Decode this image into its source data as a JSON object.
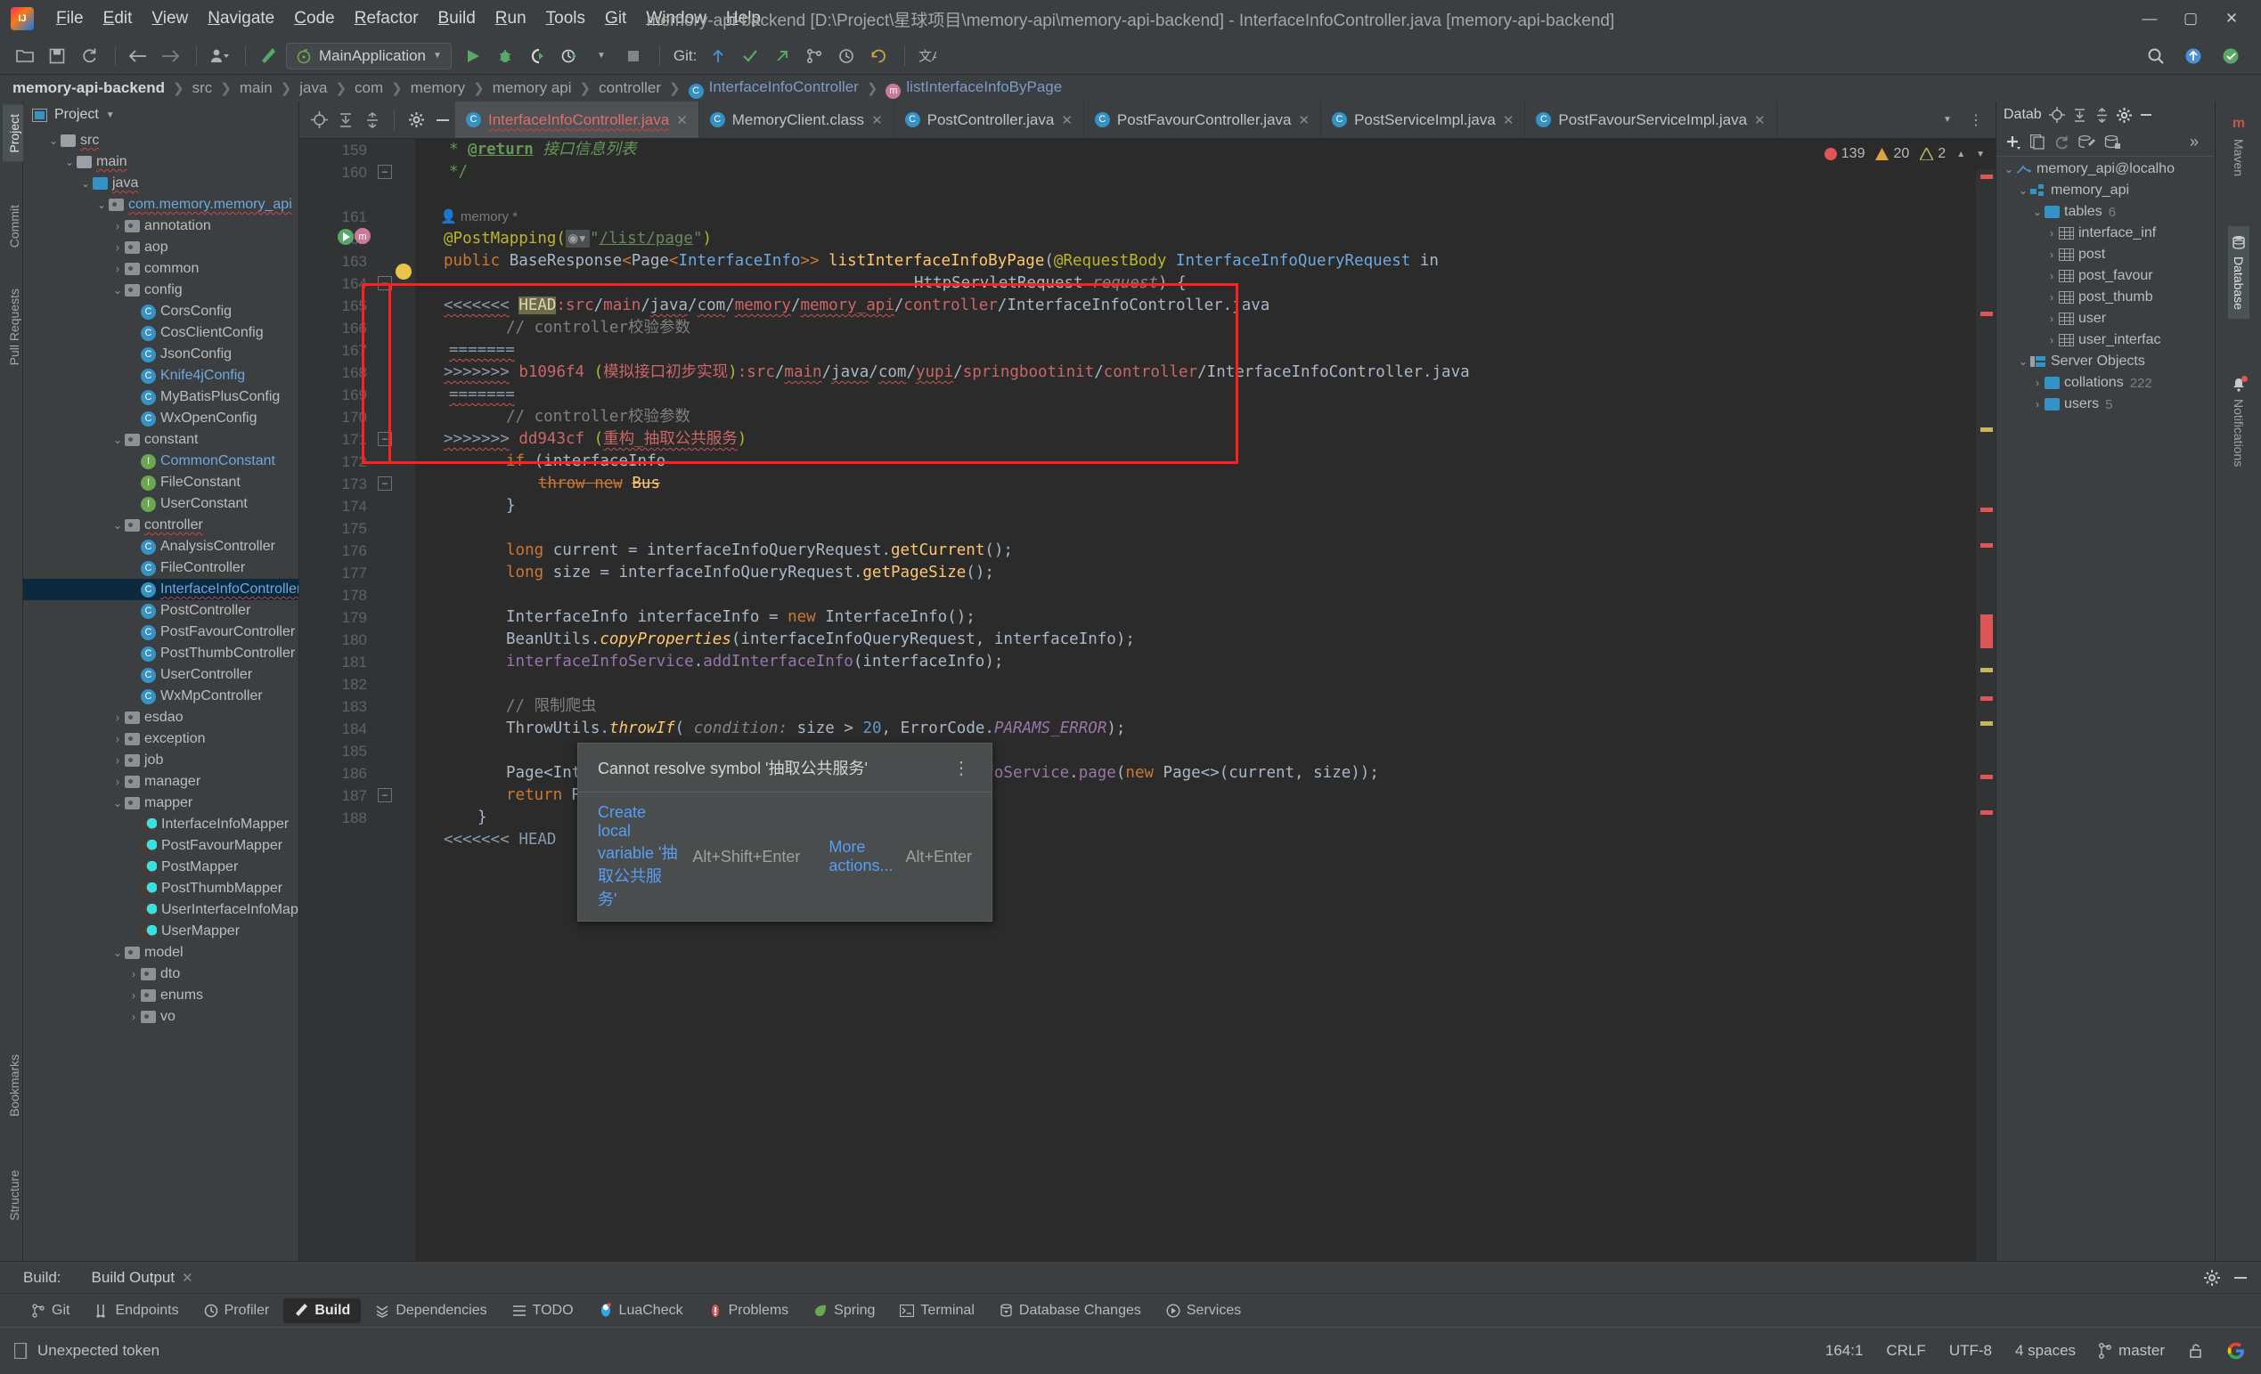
{
  "window": {
    "title": "memory-api-backend [D:\\Project\\星球项目\\memory-api\\memory-api-backend] - InterfaceInfoController.java [memory-api-backend]",
    "minimize": "—",
    "maximize": "▢",
    "close": "✕"
  },
  "menu": [
    "File",
    "Edit",
    "View",
    "Navigate",
    "Code",
    "Refactor",
    "Build",
    "Run",
    "Tools",
    "Git",
    "Window",
    "Help"
  ],
  "toolbar": {
    "run_configuration": "MainApplication",
    "git_label": "Git:",
    "icons": [
      "open-folder-icon",
      "save-icon",
      "sync-icon",
      "back-arrow-icon",
      "forward-arrow-icon",
      "user-icon",
      "build-hammer-icon",
      "run-icon",
      "debug-icon",
      "run-coverage-icon",
      "profile-icon",
      "stop-icon"
    ],
    "right_icons": [
      "search-everywhere-icon",
      "update-project-icon",
      "ide-settings-icon"
    ]
  },
  "breadcrumbs": [
    {
      "label": "memory-api-backend",
      "kind": "root"
    },
    {
      "label": "src",
      "kind": "plain"
    },
    {
      "label": "main",
      "kind": "plain"
    },
    {
      "label": "java",
      "kind": "plain"
    },
    {
      "label": "com",
      "kind": "plain"
    },
    {
      "label": "memory",
      "kind": "plain"
    },
    {
      "label": "memory api",
      "kind": "plain"
    },
    {
      "label": "controller",
      "kind": "plain"
    },
    {
      "label": "InterfaceInfoController",
      "kind": "class"
    },
    {
      "label": "listInterfaceInfoByPage",
      "kind": "method"
    }
  ],
  "left_stripe": [
    "Project",
    "Commit",
    "Pull Requests",
    "Bookmarks",
    "Structure"
  ],
  "project": {
    "title": "Project",
    "nodes": [
      {
        "depth": 1,
        "label": "src",
        "icon": "folder-grey",
        "state": "expanded",
        "err": true
      },
      {
        "depth": 2,
        "label": "main",
        "icon": "folder-grey",
        "state": "expanded",
        "err": true
      },
      {
        "depth": 3,
        "label": "java",
        "icon": "folder-blue",
        "state": "expanded",
        "err": true
      },
      {
        "depth": 4,
        "label": "com.memory.memory_api",
        "icon": "package",
        "state": "expanded",
        "blue": true,
        "err": true
      },
      {
        "depth": 5,
        "label": "annotation",
        "icon": "package",
        "state": "collapsed"
      },
      {
        "depth": 5,
        "label": "aop",
        "icon": "package",
        "state": "collapsed"
      },
      {
        "depth": 5,
        "label": "common",
        "icon": "package",
        "state": "collapsed"
      },
      {
        "depth": 5,
        "label": "config",
        "icon": "package",
        "state": "expanded"
      },
      {
        "depth": 6,
        "label": "CorsConfig",
        "icon": "class"
      },
      {
        "depth": 6,
        "label": "CosClientConfig",
        "icon": "class"
      },
      {
        "depth": 6,
        "label": "JsonConfig",
        "icon": "class"
      },
      {
        "depth": 6,
        "label": "Knife4jConfig",
        "icon": "class",
        "blue": true
      },
      {
        "depth": 6,
        "label": "MyBatisPlusConfig",
        "icon": "class"
      },
      {
        "depth": 6,
        "label": "WxOpenConfig",
        "icon": "class"
      },
      {
        "depth": 5,
        "label": "constant",
        "icon": "package",
        "state": "expanded"
      },
      {
        "depth": 6,
        "label": "CommonConstant",
        "icon": "interface",
        "blue": true
      },
      {
        "depth": 6,
        "label": "FileConstant",
        "icon": "interface"
      },
      {
        "depth": 6,
        "label": "UserConstant",
        "icon": "interface"
      },
      {
        "depth": 5,
        "label": "controller",
        "icon": "package",
        "state": "expanded",
        "err": true
      },
      {
        "depth": 6,
        "label": "AnalysisController",
        "icon": "class"
      },
      {
        "depth": 6,
        "label": "FileController",
        "icon": "class"
      },
      {
        "depth": 6,
        "label": "InterfaceInfoController",
        "icon": "class",
        "selected": true,
        "blue": true,
        "err": true
      },
      {
        "depth": 6,
        "label": "PostController",
        "icon": "class"
      },
      {
        "depth": 6,
        "label": "PostFavourController",
        "icon": "class"
      },
      {
        "depth": 6,
        "label": "PostThumbController",
        "icon": "class"
      },
      {
        "depth": 6,
        "label": "UserController",
        "icon": "class"
      },
      {
        "depth": 6,
        "label": "WxMpController",
        "icon": "class"
      },
      {
        "depth": 5,
        "label": "esdao",
        "icon": "package",
        "state": "collapsed"
      },
      {
        "depth": 5,
        "label": "exception",
        "icon": "package",
        "state": "collapsed"
      },
      {
        "depth": 5,
        "label": "job",
        "icon": "package",
        "state": "collapsed"
      },
      {
        "depth": 5,
        "label": "manager",
        "icon": "package",
        "state": "collapsed"
      },
      {
        "depth": 5,
        "label": "mapper",
        "icon": "package",
        "state": "expanded"
      },
      {
        "depth": 6,
        "label": "InterfaceInfoMapper",
        "icon": "mybatis"
      },
      {
        "depth": 6,
        "label": "PostFavourMapper",
        "icon": "mybatis"
      },
      {
        "depth": 6,
        "label": "PostMapper",
        "icon": "mybatis"
      },
      {
        "depth": 6,
        "label": "PostThumbMapper",
        "icon": "mybatis"
      },
      {
        "depth": 6,
        "label": "UserInterfaceInfoMapper",
        "icon": "mybatis"
      },
      {
        "depth": 6,
        "label": "UserMapper",
        "icon": "mybatis"
      },
      {
        "depth": 5,
        "label": "model",
        "icon": "package",
        "state": "expanded"
      },
      {
        "depth": 6,
        "label": "dto",
        "icon": "package",
        "state": "collapsed"
      },
      {
        "depth": 6,
        "label": "enums",
        "icon": "package",
        "state": "collapsed"
      },
      {
        "depth": 6,
        "label": "vo",
        "icon": "package",
        "state": "collapsed"
      }
    ]
  },
  "editor": {
    "tabs": [
      {
        "label": "InterfaceInfoController.java",
        "icon": "class-icon",
        "active": true,
        "error": true
      },
      {
        "label": "MemoryClient.class",
        "icon": "class-icon",
        "active": false
      },
      {
        "label": "PostController.java",
        "icon": "class-icon",
        "active": false
      },
      {
        "label": "PostFavourController.java",
        "icon": "class-icon",
        "active": false
      },
      {
        "label": "PostServiceImpl.java",
        "icon": "class-icon",
        "active": false
      },
      {
        "label": "PostFavourServiceImpl.java",
        "icon": "class-icon",
        "active": false
      }
    ],
    "inspections": {
      "errors": "139",
      "warnings": "20",
      "weak_warnings": "2"
    },
    "lines": [
      {
        "num": "159",
        "indent": 0
      },
      {
        "num": "160",
        "indent": 0
      },
      {
        "num": "",
        "indent": 0
      },
      {
        "num": "161",
        "indent": 0
      },
      {
        "num": "162",
        "indent": 0
      },
      {
        "num": "163",
        "indent": 0
      },
      {
        "num": "164",
        "indent": 0
      },
      {
        "num": "165",
        "indent": 0
      },
      {
        "num": "166",
        "indent": 0
      },
      {
        "num": "167",
        "indent": 0
      },
      {
        "num": "168",
        "indent": 0
      },
      {
        "num": "169",
        "indent": 0
      },
      {
        "num": "170",
        "indent": 0
      },
      {
        "num": "171",
        "indent": 0
      },
      {
        "num": "172",
        "indent": 0
      },
      {
        "num": "173",
        "indent": 0
      },
      {
        "num": "174",
        "indent": 0
      },
      {
        "num": "175",
        "indent": 0
      },
      {
        "num": "176",
        "indent": 0
      },
      {
        "num": "177",
        "indent": 0
      },
      {
        "num": "178",
        "indent": 0
      },
      {
        "num": "179",
        "indent": 0
      },
      {
        "num": "180",
        "indent": 0
      },
      {
        "num": "181",
        "indent": 0
      },
      {
        "num": "182",
        "indent": 0
      },
      {
        "num": "183",
        "indent": 0
      },
      {
        "num": "184",
        "indent": 0
      },
      {
        "num": "185",
        "indent": 0
      },
      {
        "num": "186",
        "indent": 0
      },
      {
        "num": "187",
        "indent": 0
      },
      {
        "num": "188",
        "indent": 0
      }
    ],
    "inlay_author": "memory *",
    "code_text": {
      "l159": "* @return 接口信息列表",
      "l160": "*/",
      "l161": "@PostMapping(\"/list/page\")",
      "l162": "public BaseResponse<Page<InterfaceInfo>> listInterfaceInfoByPage(@RequestBody InterfaceInfoQueryRequest in",
      "l163": "HttpServletRequest request) {",
      "l164": "<<<<<<< HEAD:src/main/java/com/memory/memory_api/controller/InterfaceInfoController.java",
      "l165": "// controller校验参数",
      "l166": "=======",
      "l167": ">>>>>>> b1096f4 (模拟接口初步实现):src/main/java/com/yupi/springbootinit/controller/InterfaceInfoController.java",
      "l168": "=======",
      "l169": "// controller校验参数",
      "l170": ">>>>>>> dd943cf (重构_抽取公共服务)",
      "l171": "if (interfaceInfo",
      "l172": "throw new Bus",
      "l173": "}",
      "l175": "long current = interfaceInfoQueryRequest.getCurrent();",
      "l176": "long size = interfaceInfoQueryRequest.getPageSize();",
      "l178": "InterfaceInfo interfaceInfo = new InterfaceInfo();",
      "l179": "BeanUtils.copyProperties(interfaceInfoQueryRequest, interfaceInfo);",
      "l180": "interfaceInfoService.addInterfaceInfo(interfaceInfo);",
      "l182": "// 限制爬虫",
      "l183": "ThrowUtils.throwIf( condition: size > 20, ErrorCode.PARAMS_ERROR);",
      "l185": "Page<InterfaceInfo> interfaceInfoPage = interfaceInfoService.page(new Page<>(current, size));",
      "l186": "return ResultUtils.success(interfaceInfoPage);",
      "l187": "}",
      "l188": "<<<<<<< HEAD"
    }
  },
  "tooltip": {
    "message": "Cannot resolve symbol '抽取公共服务'",
    "more_glyph": "⋮",
    "action_label": "Create local variable '抽取公共服务'",
    "action_shortcut": "Alt+Shift+Enter",
    "more_actions_label": "More actions...",
    "more_actions_shortcut": "Alt+Enter"
  },
  "database": {
    "title": "Database",
    "title_short": "Datab",
    "nodes": [
      {
        "depth": 0,
        "label": "memory_api@localho",
        "icon": "mysql-icon",
        "state": "expanded"
      },
      {
        "depth": 1,
        "label": "memory_api",
        "icon": "schema-icon",
        "state": "expanded"
      },
      {
        "depth": 2,
        "label": "tables",
        "icon": "folder-blue",
        "state": "expanded",
        "count": "6"
      },
      {
        "depth": 3,
        "label": "interface_inf",
        "icon": "table-icon",
        "state": "collapsed"
      },
      {
        "depth": 3,
        "label": "post",
        "icon": "table-icon",
        "state": "collapsed"
      },
      {
        "depth": 3,
        "label": "post_favour",
        "icon": "table-icon",
        "state": "collapsed"
      },
      {
        "depth": 3,
        "label": "post_thumb",
        "icon": "table-icon",
        "state": "collapsed"
      },
      {
        "depth": 3,
        "label": "user",
        "icon": "table-icon",
        "state": "collapsed"
      },
      {
        "depth": 3,
        "label": "user_interfac",
        "icon": "table-icon",
        "state": "collapsed"
      },
      {
        "depth": 1,
        "label": "Server Objects",
        "icon": "server-icon",
        "state": "expanded"
      },
      {
        "depth": 2,
        "label": "collations",
        "icon": "folder-blue",
        "state": "collapsed",
        "count": "222"
      },
      {
        "depth": 2,
        "label": "users",
        "icon": "folder-blue",
        "state": "collapsed",
        "count": "5"
      }
    ]
  },
  "right_stripe": [
    {
      "label": "Maven",
      "selected": false,
      "icon": "maven-icon"
    },
    {
      "label": "Database",
      "selected": true,
      "icon": "database-icon"
    },
    {
      "label": "Notifications",
      "selected": false,
      "icon": "bell-icon",
      "badge": true
    }
  ],
  "build_strip": {
    "title": "Build:",
    "tab": "Build Output",
    "close": "✕"
  },
  "tool_windows": [
    {
      "label": "Git",
      "icon": "git-branch-icon",
      "selected": false
    },
    {
      "label": "Endpoints",
      "icon": "endpoints-icon",
      "selected": false
    },
    {
      "label": "Profiler",
      "icon": "profiler-icon",
      "selected": false
    },
    {
      "label": "Build",
      "icon": "build-icon",
      "selected": true
    },
    {
      "label": "Dependencies",
      "icon": "dependencies-icon",
      "selected": false
    },
    {
      "label": "TODO",
      "icon": "todo-icon",
      "selected": false
    },
    {
      "label": "LuaCheck",
      "icon": "luacheck-icon",
      "selected": false
    },
    {
      "label": "Problems",
      "icon": "problems-icon",
      "selected": false
    },
    {
      "label": "Spring",
      "icon": "spring-icon",
      "selected": false
    },
    {
      "label": "Terminal",
      "icon": "terminal-icon",
      "selected": false
    },
    {
      "label": "Database Changes",
      "icon": "database-changes-icon",
      "selected": false
    },
    {
      "label": "Services",
      "icon": "services-icon",
      "selected": false
    }
  ],
  "status_bar": {
    "message": "Unexpected token",
    "caret": "164:1",
    "line_separator": "CRLF",
    "encoding": "UTF-8",
    "indent": "4 spaces",
    "branch": "master",
    "lock_icon": "unlocked-icon",
    "account_icon": "google-account-icon"
  }
}
